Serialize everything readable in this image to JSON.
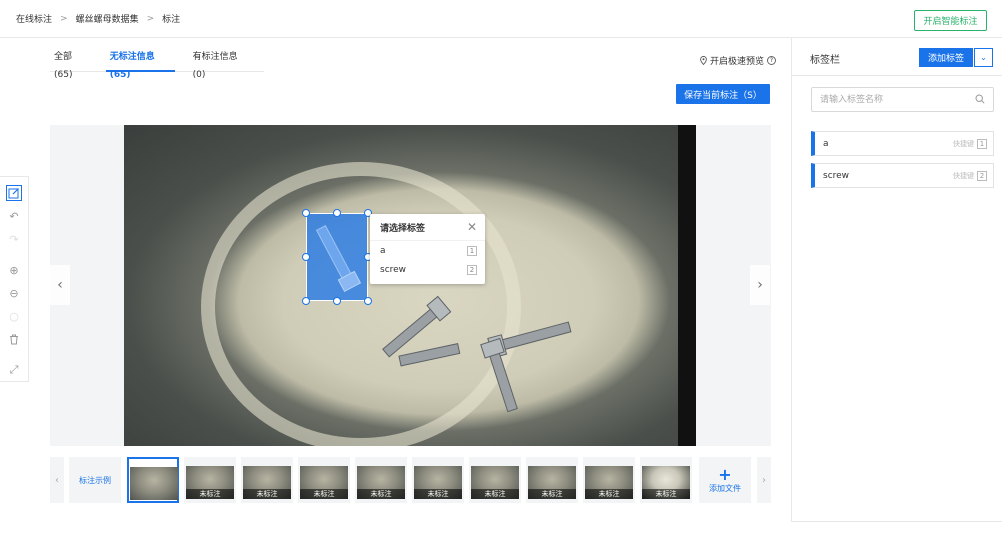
{
  "breadcrumb": [
    "在线标注",
    "螺丝螺母数据集",
    "标注"
  ],
  "header": {
    "smart_label_button": "开启智能标注"
  },
  "tabs": [
    {
      "label": "全部(65)",
      "active": false
    },
    {
      "label": "无标注信息(65)",
      "active": true
    },
    {
      "label": "有标注信息(0)",
      "active": false
    }
  ],
  "speed_preview": "开启极速预览",
  "save_button": "保存当前标注（S）",
  "popup": {
    "title": "请选择标签",
    "items": [
      {
        "name": "a",
        "key": "1"
      },
      {
        "name": "screw",
        "key": "2"
      }
    ]
  },
  "toolbar_icons": [
    "edit-icon",
    "undo-icon",
    "redo-icon",
    "zoom-in-icon",
    "zoom-out-icon",
    "circle-icon",
    "delete-icon",
    "fullscreen-icon"
  ],
  "thumbnails": {
    "example_label": "标注示例",
    "status_label": "未标注",
    "add_file_label": "添加文件",
    "count": 10,
    "selected_index": 0
  },
  "right_panel": {
    "title": "标签栏",
    "add_label_button": "添加标签",
    "search_placeholder": "请输入标签名称",
    "shortcut_text": "快捷键",
    "labels": [
      {
        "name": "a",
        "key": "1"
      },
      {
        "name": "screw",
        "key": "2"
      }
    ]
  },
  "colors": {
    "primary": "#1a73e8",
    "accent_green": "#2ab26b"
  }
}
